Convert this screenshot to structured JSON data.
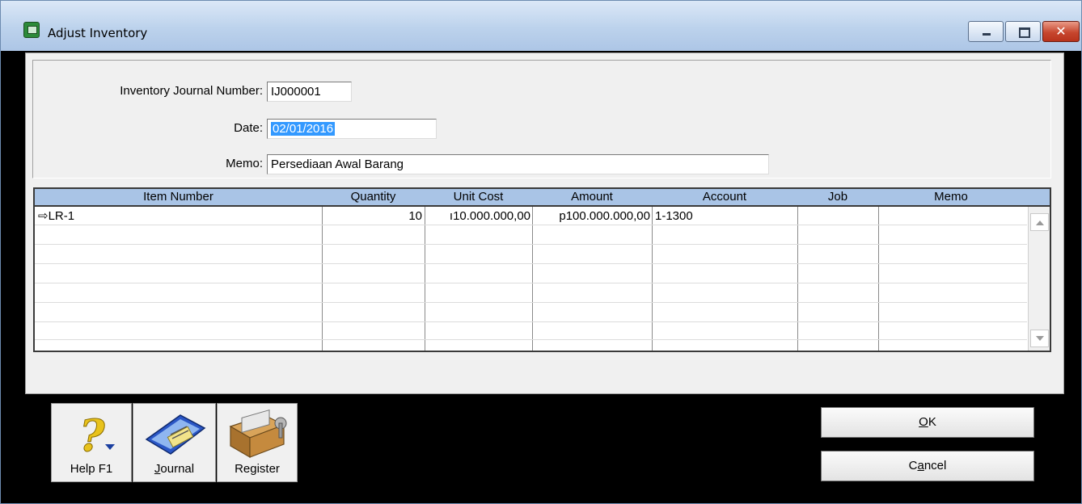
{
  "window": {
    "title": "Adjust Inventory",
    "controls": {
      "minimize": "minimize",
      "maximize": "maximize",
      "close": "✕"
    }
  },
  "form": {
    "journal_number_label": "Inventory Journal Number:",
    "journal_number_value": "IJ000001",
    "date_label": "Date:",
    "date_value": "02/01/2016",
    "memo_label": "Memo:",
    "memo_value": "Persediaan Awal Barang"
  },
  "table": {
    "columns": [
      "Item Number",
      "Quantity",
      "Unit Cost",
      "Amount",
      "Account",
      "Job",
      "Memo"
    ],
    "rows": [
      {
        "item_number": "⇨LR-1",
        "quantity": "10",
        "unit_cost": "ı10.000.000,00",
        "amount": "p100.000.000,00",
        "account": "1-1300",
        "job": "",
        "memo": ""
      }
    ]
  },
  "toolbar": {
    "help": {
      "label_prefix": "Help F1",
      "icon": "help-question-icon"
    },
    "journal": {
      "label_ul": "J",
      "label_rest": "ournal",
      "icon": "journal-book-icon"
    },
    "register": {
      "label": "Register",
      "icon": "register-cabinet-icon"
    }
  },
  "buttons": {
    "ok": {
      "ul": "O",
      "rest": "K"
    },
    "cancel": {
      "pre": "C",
      "ul": "a",
      "rest": "ncel"
    }
  }
}
